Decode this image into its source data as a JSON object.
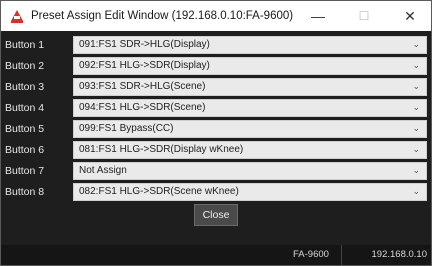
{
  "window": {
    "title": "Preset Assign Edit Window (192.168.0.10:FA-9600)",
    "minimize_glyph": "—",
    "maximize_glyph": "☐",
    "close_glyph": "✕"
  },
  "rows": [
    {
      "label": "Button 1",
      "value": "091:FS1 SDR->HLG(Display)"
    },
    {
      "label": "Button 2",
      "value": "092:FS1 HLG->SDR(Display)"
    },
    {
      "label": "Button 3",
      "value": "093:FS1 SDR->HLG(Scene)"
    },
    {
      "label": "Button 4",
      "value": "094:FS1 HLG->SDR(Scene)"
    },
    {
      "label": "Button 5",
      "value": "099:FS1 Bypass(CC)"
    },
    {
      "label": "Button 6",
      "value": "081:FS1 HLG->SDR(Display wKnee)"
    },
    {
      "label": "Button 7",
      "value": "Not Assign"
    },
    {
      "label": "Button 8",
      "value": "082:FS1 HLG->SDR(Scene wKnee)"
    }
  ],
  "close_button": {
    "label": "Close"
  },
  "status": {
    "device": "FA-9600",
    "ip": "192.168.0.10"
  },
  "icons": {
    "app": "app-logo-icon",
    "dropdown": "chevron-down-icon"
  },
  "colors": {
    "app_icon": "#d4322a",
    "background": "#1e1e1e",
    "select_bg": "#eaeaea"
  }
}
